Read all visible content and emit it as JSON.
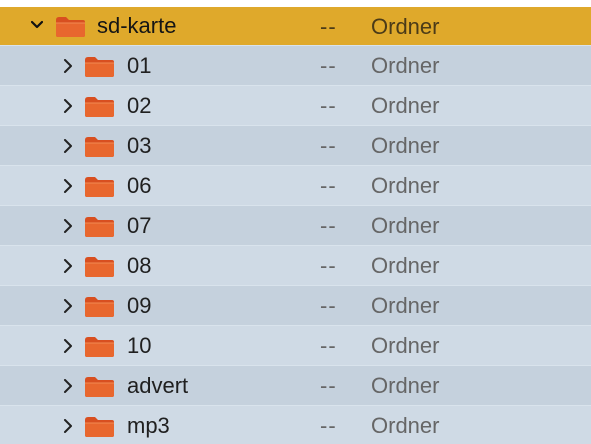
{
  "folder_list": {
    "parent": {
      "name": "sd-karte",
      "size": "--",
      "kind": "Ordner",
      "expanded": true,
      "icon": "folder-icon"
    },
    "children": [
      {
        "name": "01",
        "size": "--",
        "kind": "Ordner",
        "icon": "folder-icon"
      },
      {
        "name": "02",
        "size": "--",
        "kind": "Ordner",
        "icon": "folder-icon"
      },
      {
        "name": "03",
        "size": "--",
        "kind": "Ordner",
        "icon": "folder-icon"
      },
      {
        "name": "06",
        "size": "--",
        "kind": "Ordner",
        "icon": "folder-icon"
      },
      {
        "name": "07",
        "size": "--",
        "kind": "Ordner",
        "icon": "folder-icon"
      },
      {
        "name": "08",
        "size": "--",
        "kind": "Ordner",
        "icon": "folder-icon"
      },
      {
        "name": "09",
        "size": "--",
        "kind": "Ordner",
        "icon": "folder-icon"
      },
      {
        "name": "10",
        "size": "--",
        "kind": "Ordner",
        "icon": "folder-icon"
      },
      {
        "name": "advert",
        "size": "--",
        "kind": "Ordner",
        "icon": "folder-icon"
      },
      {
        "name": "mp3",
        "size": "--",
        "kind": "Ordner",
        "icon": "folder-icon"
      }
    ]
  },
  "colors": {
    "selected_row": "#dfa92b",
    "row_light": "#cfdae5",
    "row_dark": "#c5d1dd",
    "folder_orange": "#e8672e",
    "folder_dark": "#d84f20"
  }
}
